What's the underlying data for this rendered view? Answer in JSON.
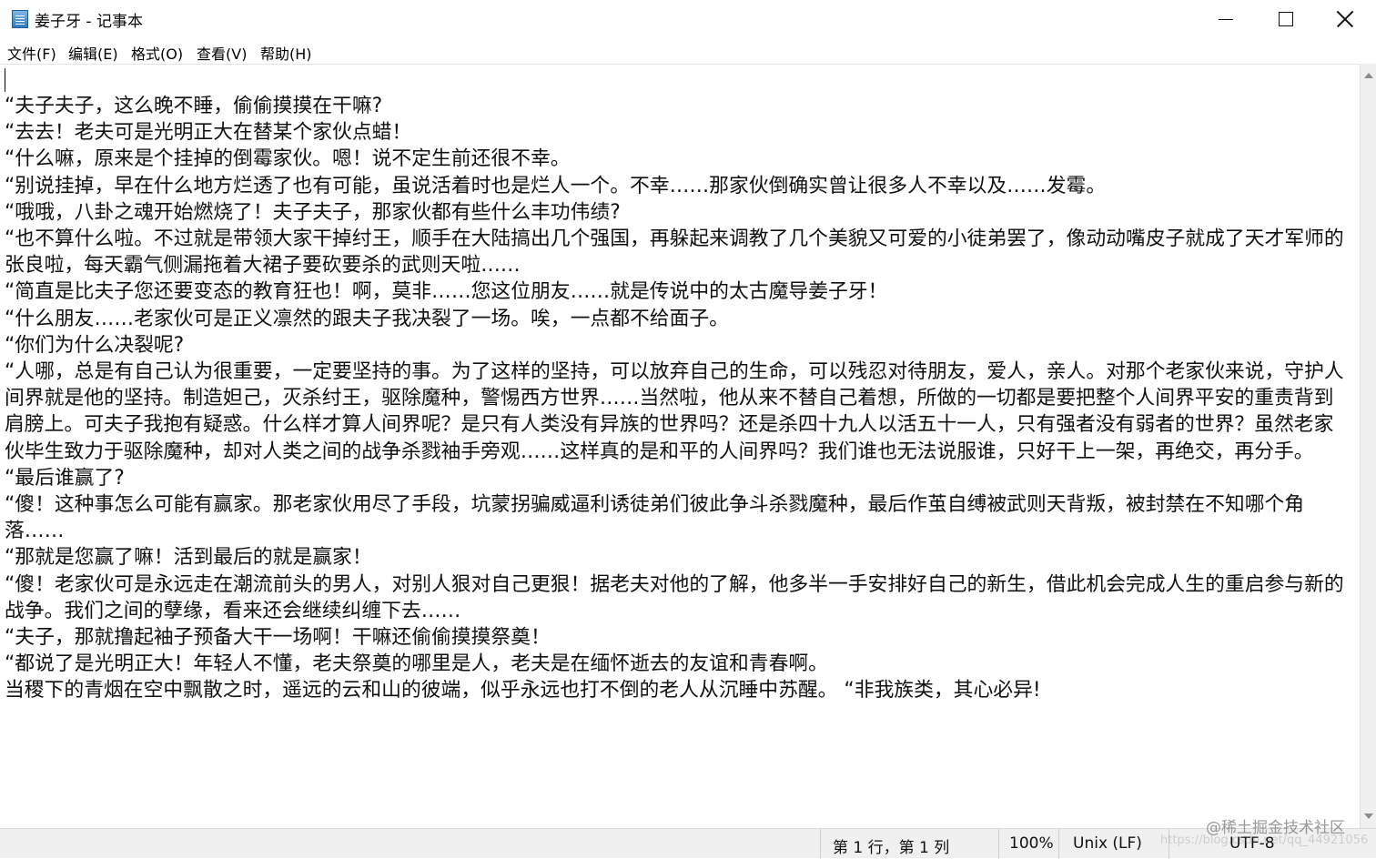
{
  "window": {
    "title": "姜子牙 - 记事本",
    "minimize_glyph": "",
    "maximize_glyph": "",
    "close_glyph": ""
  },
  "menu": {
    "items": [
      "文件(F)",
      "编辑(E)",
      "格式(O)",
      "查看(V)",
      "帮助(H)"
    ]
  },
  "document": {
    "lines": [
      "“夫子夫子，这么晚不睡，偷偷摸摸在干嘛?",
      "“去去！老夫可是光明正大在替某个家伙点蜡！",
      "“什么嘛，原来是个挂掉的倒霉家伙。嗯！说不定生前还很不幸。",
      "“别说挂掉，早在什么地方烂透了也有可能，虽说活着时也是烂人一个。不幸……那家伙倒确实曾让很多人不幸以及……发霉。",
      "“哦哦，八卦之魂开始燃烧了！夫子夫子，那家伙都有些什么丰功伟绩?",
      "“也不算什么啦。不过就是带领大家干掉纣王，顺手在大陆搞出几个强国，再躲起来调教了几个美貌又可爱的小徒弟罢了，像动动嘴皮子就成了天才军师的张良啦，每天霸气侧漏拖着大裙子要砍要杀的武则天啦……",
      "“简直是比夫子您还要变态的教育狂也！啊，莫非……您这位朋友……就是传说中的太古魔导姜子牙！",
      "“什么朋友……老家伙可是正义凛然的跟夫子我决裂了一场。唉，一点都不给面子。",
      "“你们为什么决裂呢?",
      "“人哪，总是有自己认为很重要，一定要坚持的事。为了这样的坚持，可以放弃自己的生命，可以残忍对待朋友，爱人，亲人。对那个老家伙来说，守护人间界就是他的坚持。制造妲己，灭杀纣王，驱除魔种，警惕西方世界……当然啦，他从来不替自己着想，所做的一切都是要把整个人间界平安的重责背到肩膀上。可夫子我抱有疑惑。什么样才算人间界呢？是只有人类没有异族的世界吗？还是杀四十九人以活五十一人，只有强者没有弱者的世界？虽然老家伙毕生致力于驱除魔种，却对人类之间的战争杀戮袖手旁观……这样真的是和平的人间界吗？我们谁也无法说服谁，只好干上一架，再绝交，再分手。",
      "“最后谁赢了?",
      "“傻！这种事怎么可能有赢家。那老家伙用尽了手段，坑蒙拐骗威逼利诱徒弟们彼此争斗杀戮魔种，最后作茧自缚被武则天背叛，被封禁在不知哪个角落……",
      "“那就是您赢了嘛！活到最后的就是赢家！",
      "“傻！老家伙可是永远走在潮流前头的男人，对别人狠对自己更狠！据老夫对他的了解，他多半一手安排好自己的新生，借此机会完成人生的重启参与新的战争。我们之间的孽缘，看来还会继续纠缠下去……",
      "“夫子，那就撸起袖子预备大干一场啊！干嘛还偷偷摸摸祭奠！",
      "“都说了是光明正大！年轻人不懂，老夫祭奠的哪里是人，老夫是在缅怀逝去的友谊和青春啊。",
      "当稷下的青烟在空中飘散之时，遥远的云和山的彼端，似乎永远也打不倒的老人从沉睡中苏醒。 “非我族类，其心必异!"
    ]
  },
  "status": {
    "position": "第 1 行，第 1 列",
    "zoom": "100%",
    "line_ending": "Unix (LF)",
    "encoding": "UTF-8"
  },
  "watermark": {
    "text": "@稀土掘金技术社区",
    "subtext": "https://blog.csdn.net/qq_44921056"
  },
  "colors": {
    "background": "#ffffff",
    "statusbar": "#f0f0f0",
    "text": "#111111"
  }
}
